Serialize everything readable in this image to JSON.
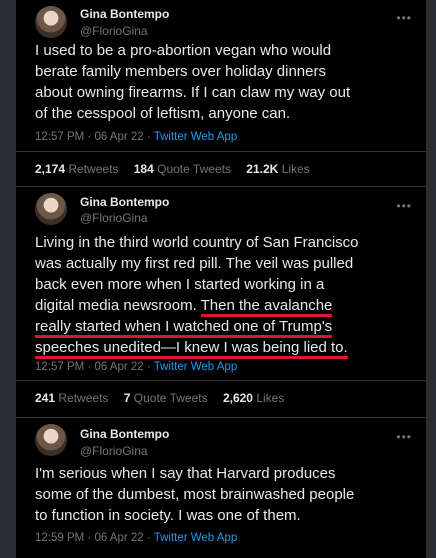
{
  "tweets": [
    {
      "name": "Gina Bontempo",
      "handle": "@FlorioGina",
      "text_lines": [
        "I used to be a pro-abortion vegan who would",
        "berate family members over holiday dinners",
        "about owning firearms. If I can claw my way out",
        "of the cesspool of leftism, anyone can."
      ],
      "time": "12:57 PM · 06 Apr 22 · ",
      "app": "Twitter Web App",
      "retweets": "2,174",
      "retweets_label": "Retweets",
      "quotes": "184",
      "quotes_label": "Quote Tweets",
      "likes": "21.2K",
      "likes_label": "Likes",
      "more_icon": "more-dots-icon"
    },
    {
      "name": "Gina Bontempo",
      "handle": "@FlorioGina",
      "plain_lines": [
        "Living in the third world country of San Francisco",
        "was actually my first red pill. The veil was pulled",
        "back even more when I started working in a"
      ],
      "line4_plain": "digital media newsroom. ",
      "line4_hl": "Then the avalanche",
      "hl_lines": [
        "really started when I watched one of Trump's",
        "speeches unedited—I knew I was being lied to."
      ],
      "time": "12:57 PM · 06 Apr 22 · ",
      "app": "Twitter Web App",
      "retweets": "241",
      "retweets_label": "Retweets",
      "quotes": "7",
      "quotes_label": "Quote Tweets",
      "likes": "2,620",
      "likes_label": "Likes",
      "highlight_color": "#e0142f"
    },
    {
      "name": "Gina Bontempo",
      "handle": "@FlorioGina",
      "text_lines": [
        "I'm serious when I say that Harvard produces",
        "some of the dumbest, most brainwashed people",
        "to function in society. I was one of them."
      ],
      "time": "12:59 PM · 06 Apr 22 · ",
      "app": "Twitter Web App"
    }
  ],
  "more_glyph": "•••",
  "colors": {
    "background": "#000000",
    "text": "#e7e9ea",
    "muted": "#71767b",
    "link": "#1d9bf0",
    "border": "#2f3336"
  }
}
